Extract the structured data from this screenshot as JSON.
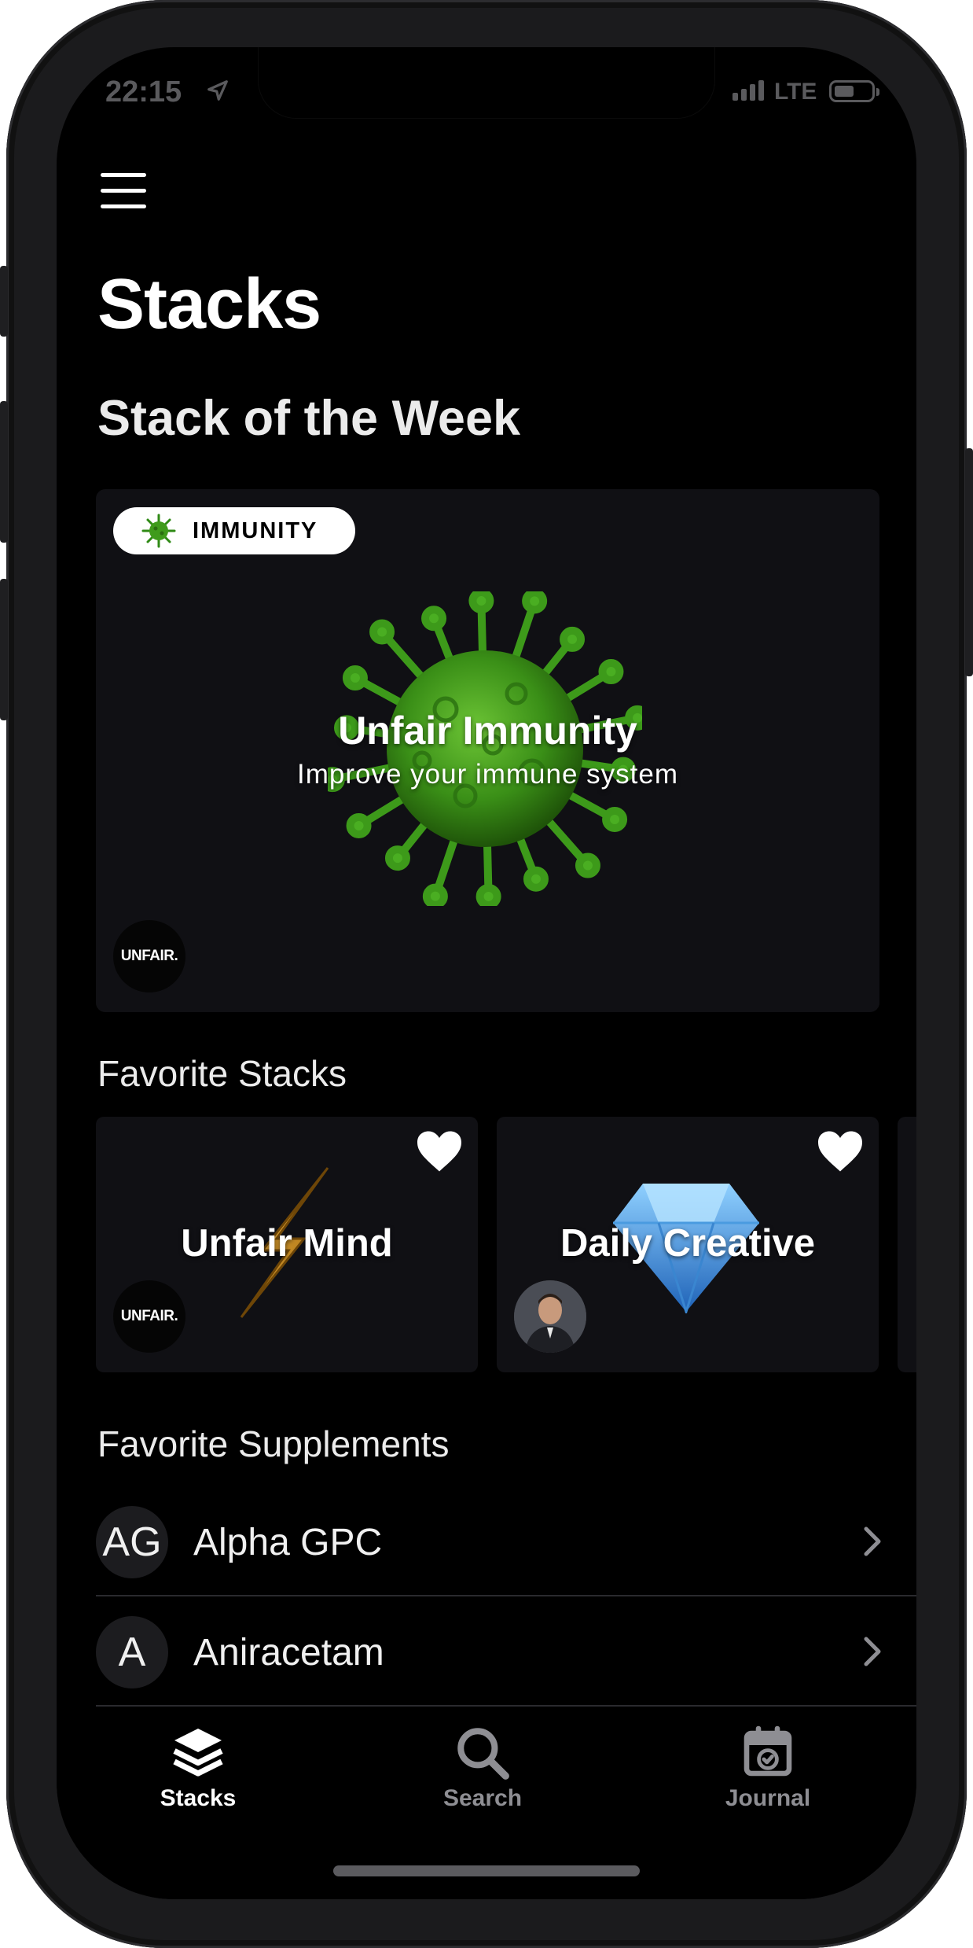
{
  "status_bar": {
    "time": "22:15",
    "network": "LTE"
  },
  "header": {
    "title": "Stacks"
  },
  "stack_of_week": {
    "heading": "Stack of the Week",
    "badge": "IMMUNITY",
    "title": "Unfair Immunity",
    "subtitle": "Improve your immune system",
    "brand": "UNFAIR."
  },
  "favorite_stacks": {
    "heading": "Favorite Stacks",
    "items": [
      {
        "title": "Unfair Mind",
        "brand": "UNFAIR.",
        "favorited": true
      },
      {
        "title": "Daily Creative",
        "favorited": true
      }
    ]
  },
  "favorite_supplements": {
    "heading": "Favorite Supplements",
    "items": [
      {
        "initials": "AG",
        "name": "Alpha GPC"
      },
      {
        "initials": "A",
        "name": "Aniracetam"
      }
    ]
  },
  "tabs": [
    {
      "label": "Stacks",
      "icon": "stack-layers-icon",
      "active": true
    },
    {
      "label": "Search",
      "icon": "search-icon",
      "active": false
    },
    {
      "label": "Journal",
      "icon": "calendar-check-icon",
      "active": false
    }
  ],
  "colors": {
    "background": "#000000",
    "card": "#101014",
    "active_tab": "#ffffff",
    "inactive_tab": "#8e8e93",
    "virus_green": "#3f9b1b"
  }
}
